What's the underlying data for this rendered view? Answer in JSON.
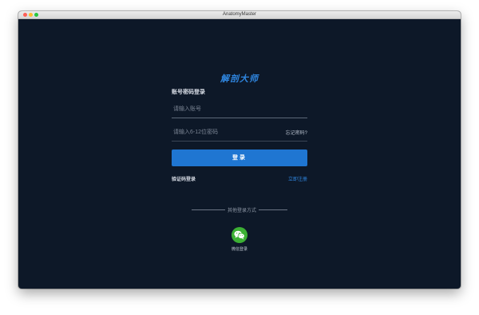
{
  "window": {
    "title": "AnatomyMaster"
  },
  "app": {
    "title": "解剖大师"
  },
  "login": {
    "mode_label": "账号密码登录",
    "account_placeholder": "请输入账号",
    "password_placeholder": "请输入6-12位密码",
    "forgot_password": "忘记密码?",
    "submit_label": "登录",
    "sms_login": "验证码登录",
    "register": "立即注册"
  },
  "other_login": {
    "label": "其他登录方式",
    "wechat_label": "微信登录",
    "wechat_icon": "wechat-icon",
    "wechat_color": "#3cb034"
  },
  "colors": {
    "background": "#0d1828",
    "accent": "#1f76d2"
  }
}
